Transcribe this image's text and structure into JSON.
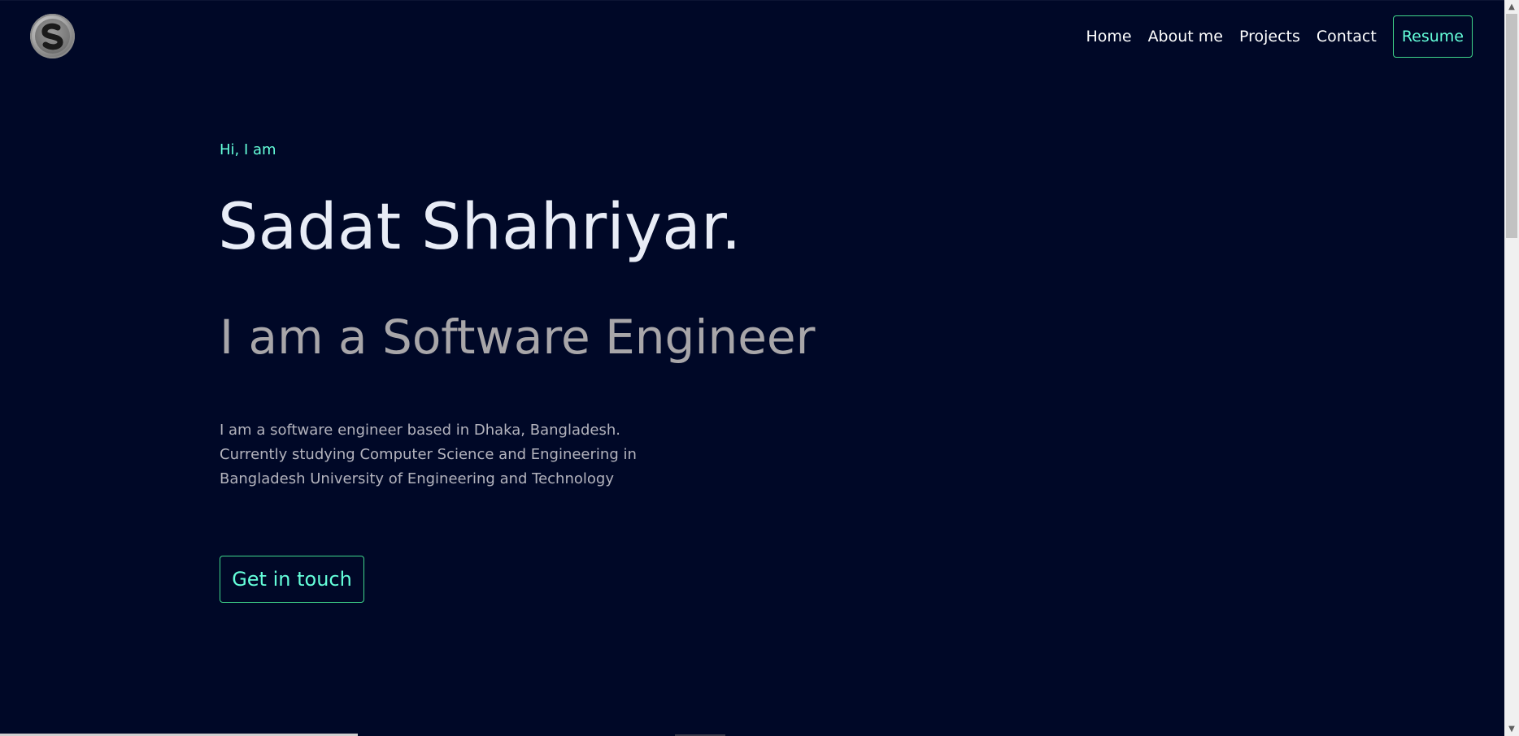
{
  "header": {
    "logo_letter": "S",
    "nav": [
      {
        "label": "Home"
      },
      {
        "label": "About me"
      },
      {
        "label": "Projects"
      },
      {
        "label": "Contact"
      }
    ],
    "resume_label": "Resume"
  },
  "hero": {
    "greeting": "Hi, I am",
    "name": "Sadat Shahriyar.",
    "role": "I am a Software Engineer",
    "bio_lines": [
      "I am a software engineer based in Dhaka, Bangladesh.",
      "Currently studying Computer Science and Engineering in",
      "Bangladesh University of Engineering and Technology"
    ],
    "cta_label": "Get in touch"
  },
  "colors": {
    "background": "#000827",
    "accent": "#64ffda",
    "border_accent": "#3fd68b",
    "heading": "#e8ecf6",
    "muted": "#a8a6a9"
  },
  "icons": {
    "logo": "s-logo-icon",
    "scroll_up": "chevron-up-icon",
    "scroll_down": "chevron-down-icon"
  }
}
